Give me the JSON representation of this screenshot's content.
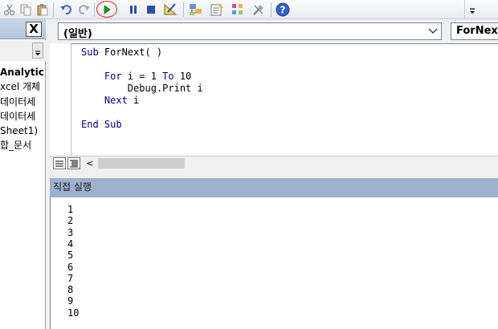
{
  "toolbar": {
    "icons": [
      "cut-icon",
      "copy-icon",
      "paste-icon",
      "undo-icon",
      "redo-icon",
      "run-icon",
      "break-icon",
      "reset-icon",
      "design-mode-icon",
      "project-explorer-icon",
      "properties-icon",
      "object-browser-icon",
      "toolbox-icon",
      "help-icon"
    ],
    "highlight_color": "#e02020"
  },
  "project_pane": {
    "close_label": "X",
    "items": [
      "Analytic",
      "xcel 개체",
      "데이터세",
      "데이터세",
      "Sheet1)",
      "합_문서"
    ]
  },
  "code_window": {
    "object_combo": "(일반)",
    "procedure_combo": "ForNext",
    "lines": [
      {
        "parts": [
          {
            "t": "Sub",
            "kw": true
          },
          {
            "t": " ForNext( )",
            "kw": false
          }
        ]
      },
      {
        "parts": []
      },
      {
        "parts": [
          {
            "t": "    For",
            "kw": true
          },
          {
            "t": " i = 1 ",
            "kw": false
          },
          {
            "t": "To",
            "kw": true
          },
          {
            "t": " 10",
            "kw": false
          }
        ]
      },
      {
        "parts": [
          {
            "t": "        Debug.Print i",
            "kw": false
          }
        ]
      },
      {
        "parts": [
          {
            "t": "    Next",
            "kw": true
          },
          {
            "t": " i",
            "kw": false
          }
        ]
      },
      {
        "parts": []
      },
      {
        "parts": [
          {
            "t": "End Sub",
            "kw": true
          }
        ]
      }
    ],
    "scroll_left_glyph": "<"
  },
  "immediate_window": {
    "title": "직접 실행",
    "output": [
      "1",
      "2",
      "3",
      "4",
      "5",
      "6",
      "7",
      "8",
      "9",
      "10"
    ]
  },
  "colors": {
    "keyword": "#00007f",
    "pane_header": "#9db1cf"
  }
}
